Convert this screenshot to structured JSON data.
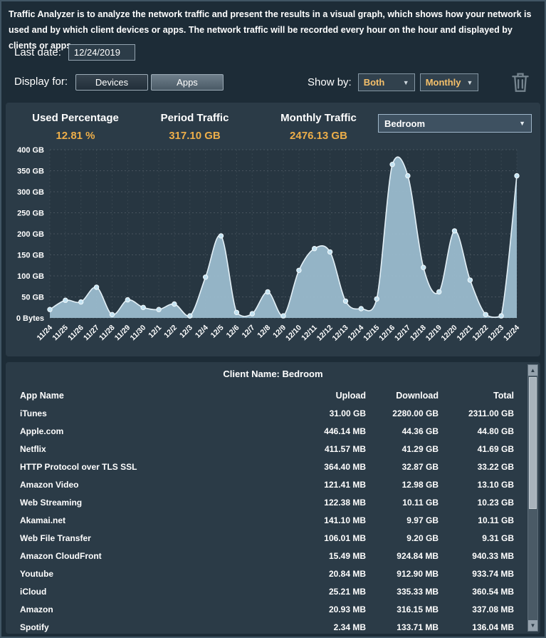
{
  "colors": {
    "page_bg": "#1d2c37",
    "panel_bg": "#2b3b47",
    "accent_amber": "#edae49",
    "chart_area_fill": "#9dbfd1",
    "chart_line": "#e4f1f8",
    "text": "#ffffff"
  },
  "description": "Traffic Analyzer is to analyze the network traffic and present the results in a visual graph, which shows how your network is used and by which client devices or apps. The network traffic will be recorded every hour on the hour and displayed by clients or apps.",
  "last_date": {
    "label": "Last date:",
    "value": "12/24/2019"
  },
  "controls": {
    "display_for_label": "Display for:",
    "devices_label": "Devices",
    "apps_label": "Apps",
    "show_by_label": "Show by:",
    "show_by_value": "Both",
    "period_value": "Monthly",
    "trash_icon": "trash-icon",
    "dropdown_arrow": "▼"
  },
  "stats": {
    "used": {
      "label": "Used Percentage",
      "value": "12.81 %"
    },
    "period": {
      "label": "Period Traffic",
      "value": "317.10 GB"
    },
    "monthly": {
      "label": "Monthly Traffic",
      "value": "2476.13 GB"
    },
    "client": "Bedroom"
  },
  "chart_data": {
    "type": "area",
    "title": "",
    "xlabel": "",
    "ylabel": "",
    "ylim": [
      0,
      400
    ],
    "grid": true,
    "legend": "none",
    "ytick_labels": [
      "0 Bytes",
      "50 GB",
      "100 GB",
      "150 GB",
      "200 GB",
      "250 GB",
      "300 GB",
      "350 GB",
      "400 GB"
    ],
    "ytick_values": [
      0,
      50,
      100,
      150,
      200,
      250,
      300,
      350,
      400
    ],
    "x": [
      "11/24",
      "11/25",
      "11/26",
      "11/27",
      "11/28",
      "11/29",
      "11/30",
      "12/1",
      "12/2",
      "12/3",
      "12/4",
      "12/5",
      "12/6",
      "12/7",
      "12/8",
      "12/9",
      "12/10",
      "12/11",
      "12/12",
      "12/13",
      "12/14",
      "12/15",
      "12/16",
      "12/17",
      "12/18",
      "12/19",
      "12/20",
      "12/21",
      "12/22",
      "12/23",
      "12/24"
    ],
    "values": [
      20,
      42,
      38,
      73,
      8,
      43,
      25,
      20,
      33,
      5,
      97,
      195,
      13,
      10,
      62,
      5,
      113,
      165,
      157,
      40,
      22,
      45,
      365,
      338,
      120,
      62,
      207,
      90,
      8,
      5,
      338
    ],
    "unit": "GB"
  },
  "table": {
    "title": "Client Name: Bedroom",
    "columns": [
      "App Name",
      "Upload",
      "Download",
      "Total"
    ],
    "rows": [
      [
        "iTunes",
        "31.00 GB",
        "2280.00 GB",
        "2311.00 GB"
      ],
      [
        "Apple.com",
        "446.14 MB",
        "44.36 GB",
        "44.80 GB"
      ],
      [
        "Netflix",
        "411.57 MB",
        "41.29 GB",
        "41.69 GB"
      ],
      [
        "HTTP Protocol over TLS SSL",
        "364.40 MB",
        "32.87 GB",
        "33.22 GB"
      ],
      [
        "Amazon Video",
        "121.41 MB",
        "12.98 GB",
        "13.10 GB"
      ],
      [
        "Web Streaming",
        "122.38 MB",
        "10.11 GB",
        "10.23 GB"
      ],
      [
        "Akamai.net",
        "141.10 MB",
        "9.97 GB",
        "10.11 GB"
      ],
      [
        "Web File Transfer",
        "106.01 MB",
        "9.20 GB",
        "9.31 GB"
      ],
      [
        "Amazon CloudFront",
        "15.49 MB",
        "924.84 MB",
        "940.33 MB"
      ],
      [
        "Youtube",
        "20.84 MB",
        "912.90 MB",
        "933.74 MB"
      ],
      [
        "iCloud",
        "25.21 MB",
        "335.33 MB",
        "360.54 MB"
      ],
      [
        "Amazon",
        "20.93 MB",
        "316.15 MB",
        "337.08 MB"
      ],
      [
        "Spotify",
        "2.34 MB",
        "133.71 MB",
        "136.04 MB"
      ]
    ]
  }
}
